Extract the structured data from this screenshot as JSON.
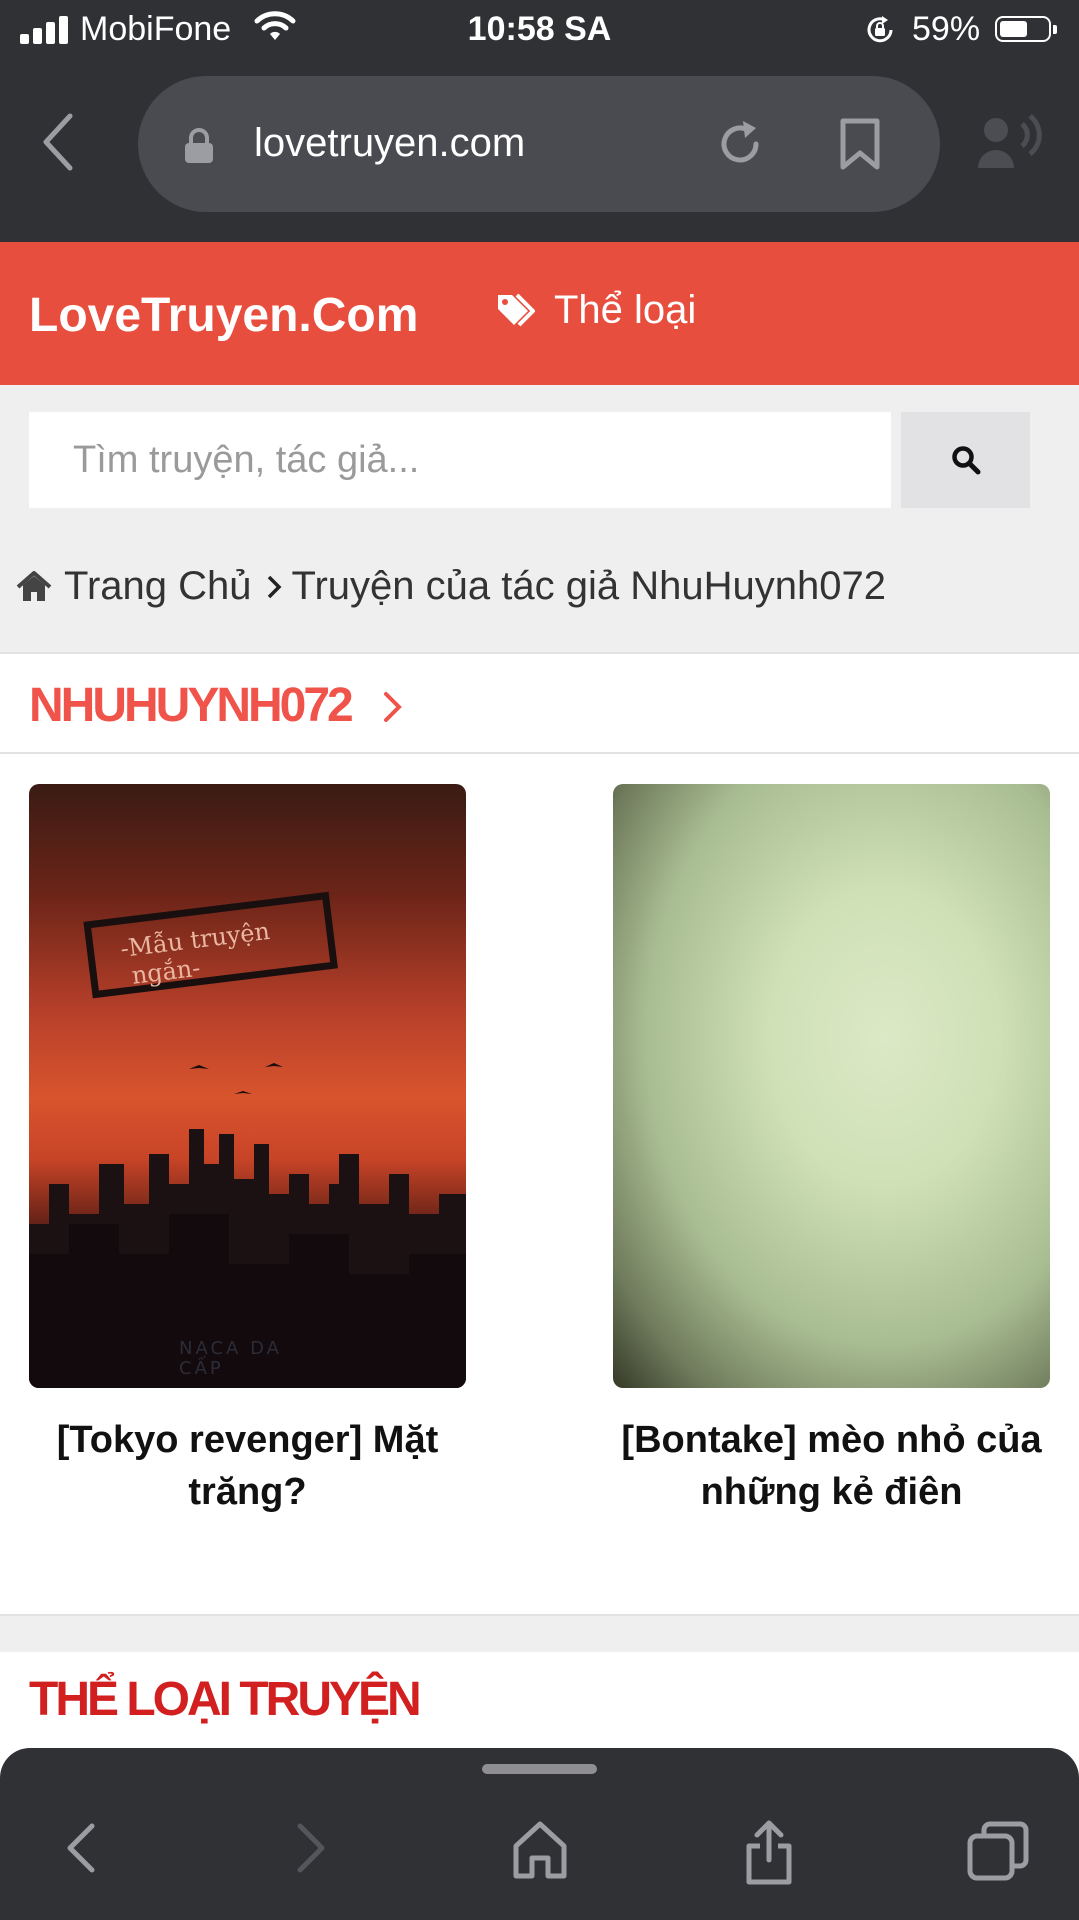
{
  "status_bar": {
    "carrier": "MobiFone",
    "time": "10:58 SA",
    "battery_percent": "59%",
    "battery_level": 0.59
  },
  "browser": {
    "url": "lovetruyen.com",
    "icons": [
      "back-icon",
      "lock-icon",
      "reload-icon",
      "bookmark-icon",
      "speaker-icon"
    ]
  },
  "site": {
    "brand": "LoveTruyen.Com",
    "genre_link": "Thể loại",
    "accent_color": "#e84e3e"
  },
  "search": {
    "placeholder": "Tìm truyện, tác giả..."
  },
  "breadcrumb": {
    "home": "Trang Chủ",
    "current": "Truyện của tác giả NhuHuynh072"
  },
  "author_section": {
    "title": "NHUHUYNH072",
    "stories": [
      {
        "title": "[Tokyo revenger] Mặt trăng?",
        "cover_text": "-Mẫu truyện ngắn-",
        "cover_footer": "NACA DA CẤP"
      },
      {
        "title": "[Bontake] mèo nhỏ của những kẻ điên"
      }
    ]
  },
  "genre_section": {
    "title": "THỂ LOẠI TRUYỆN"
  },
  "toolbar": {
    "icons": [
      "back-icon",
      "forward-icon",
      "home-icon",
      "share-icon",
      "tabs-icon"
    ]
  }
}
